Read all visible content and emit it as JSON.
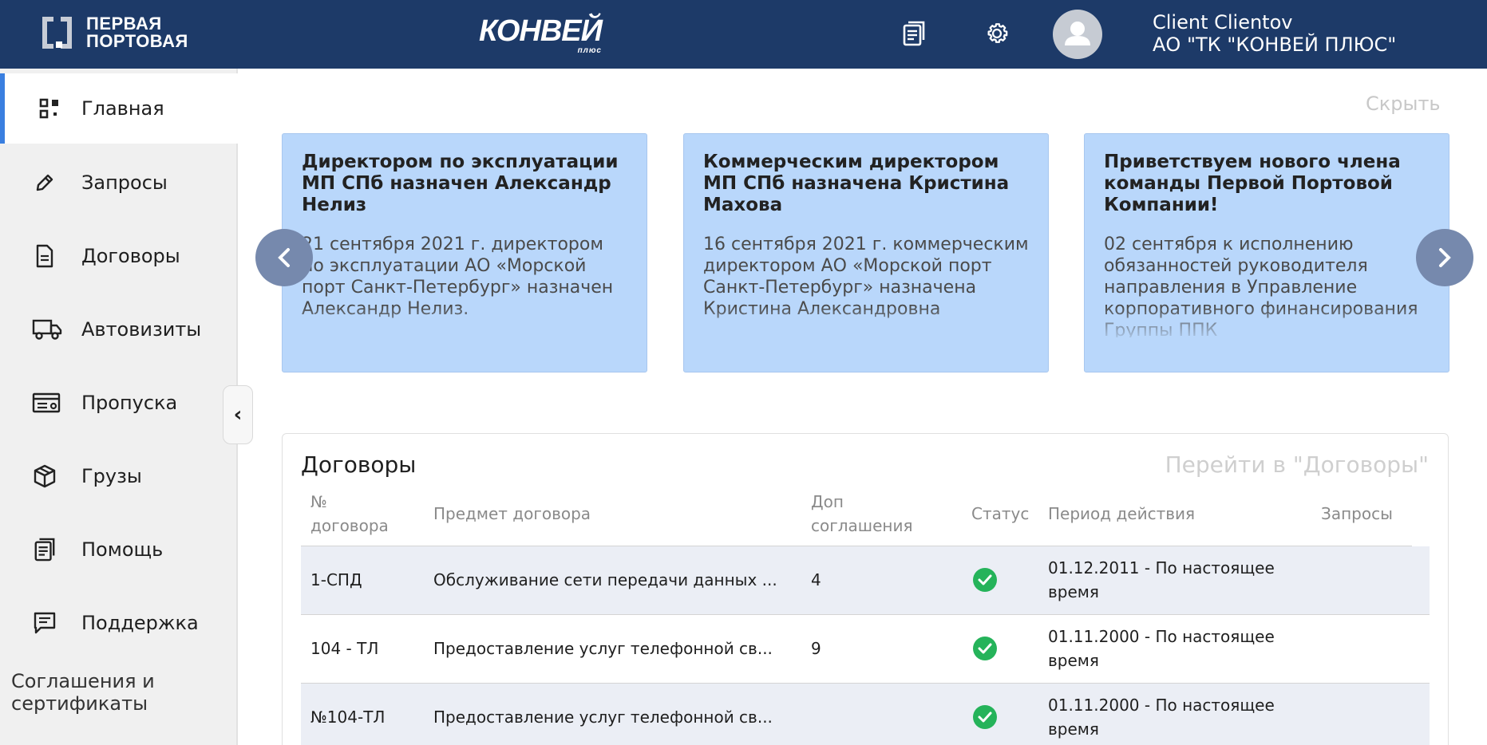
{
  "header": {
    "logo_left_line1": "ПЕРВАЯ",
    "logo_left_line2": "ПОРТОВАЯ",
    "logo_center": "КОНВЕЙ",
    "logo_center_sub": "плюс",
    "user_name": "Client Clientov",
    "user_company": "АО \"ТК \"КОНВЕЙ ПЛЮС\""
  },
  "sidebar": {
    "items": [
      {
        "label": "Главная",
        "icon": "dashboard-icon"
      },
      {
        "label": "Запросы",
        "icon": "pencil-icon"
      },
      {
        "label": "Договоры",
        "icon": "document-icon"
      },
      {
        "label": "Автовизиты",
        "icon": "truck-icon"
      },
      {
        "label": "Пропуска",
        "icon": "pass-card-icon"
      },
      {
        "label": "Грузы",
        "icon": "cube-icon"
      },
      {
        "label": "Помощь",
        "icon": "help-book-icon"
      },
      {
        "label": "Поддержка",
        "icon": "chat-icon"
      }
    ],
    "extra_line1": "Соглашения и",
    "extra_line2": "сертификаты",
    "collapse_glyph": "‹"
  },
  "news": {
    "hide_label": "Скрыть",
    "cards": [
      {
        "title": "Директором по эксплуатации МП СПб назначен Александр Нелиз",
        "body": "21 сентября 2021 г. директором по эксплуатации АО «Морской порт Санкт-Петербург» назначен Александр Нелиз."
      },
      {
        "title": "Коммерческим директором МП СПб назначена Кристина Махова",
        "body": "16 сентября 2021 г. коммерческим директором АО «Морской порт Санкт-Петербург» назначена Кристина Александровна"
      },
      {
        "title": "Приветствуем нового члена команды Первой Портовой Компании!",
        "body": "02 сентября к исполнению обязанностей руководителя направления в Управление корпоративного финансирования Группы ППК"
      }
    ]
  },
  "contracts": {
    "title": "Договоры",
    "link": "Перейти в \"Договоры\"",
    "columns": {
      "number_line1": "№",
      "number_line2": "договора",
      "subject": "Предмет договора",
      "addenda_line1": "Доп",
      "addenda_line2": "соглашения",
      "status": "Статус",
      "period": "Период действия",
      "requests": "Запросы"
    },
    "rows": [
      {
        "number": "1-СПД",
        "subject": "Обслуживание сети передачи данных ...",
        "addenda": "4",
        "period_line1": "01.12.2011 - По настоящее",
        "period_line2": "время",
        "status": "active"
      },
      {
        "number": "104 - ТЛ",
        "subject": "Предоставление услуг телефонной св...",
        "addenda": "9",
        "period_line1": "01.11.2000 - По настоящее",
        "period_line2": "время",
        "status": "active"
      },
      {
        "number": "№104-ТЛ",
        "subject": "Предоставление услуг телефонной св...",
        "addenda": "",
        "period_line1": "01.11.2000 - По настоящее",
        "period_line2": "время",
        "status": "active"
      }
    ]
  },
  "colors": {
    "header_bg": "#1d3a68",
    "accent": "#3a7fe0",
    "card_bg": "#b9d7fb",
    "status_ok": "#25b35a"
  }
}
